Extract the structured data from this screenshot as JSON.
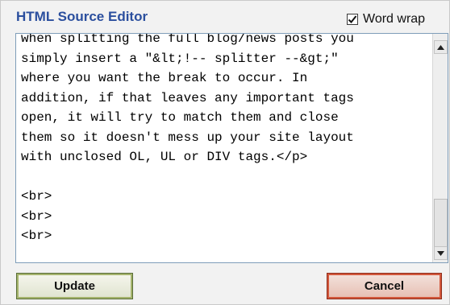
{
  "dialog": {
    "title": "HTML Source Editor",
    "word_wrap": {
      "label": "Word wrap",
      "checked": true
    },
    "editor": {
      "content": "when splitting the full blog/news posts you\nsimply insert a \"&lt;!-- splitter --&gt;\"\nwhere you want the break to occur. In\naddition, if that leaves any important tags\nopen, it will try to match them and close\nthem so it doesn't mess up your site layout\nwith unclosed OL, UL or DIV tags.</p>\n\n<br>\n<br>\n<br>"
    },
    "buttons": {
      "update": "Update",
      "cancel": "Cancel"
    }
  },
  "colors": {
    "title": "#2b4f9e",
    "update_border": "#a4b36c",
    "cancel_border": "#d2573c"
  }
}
